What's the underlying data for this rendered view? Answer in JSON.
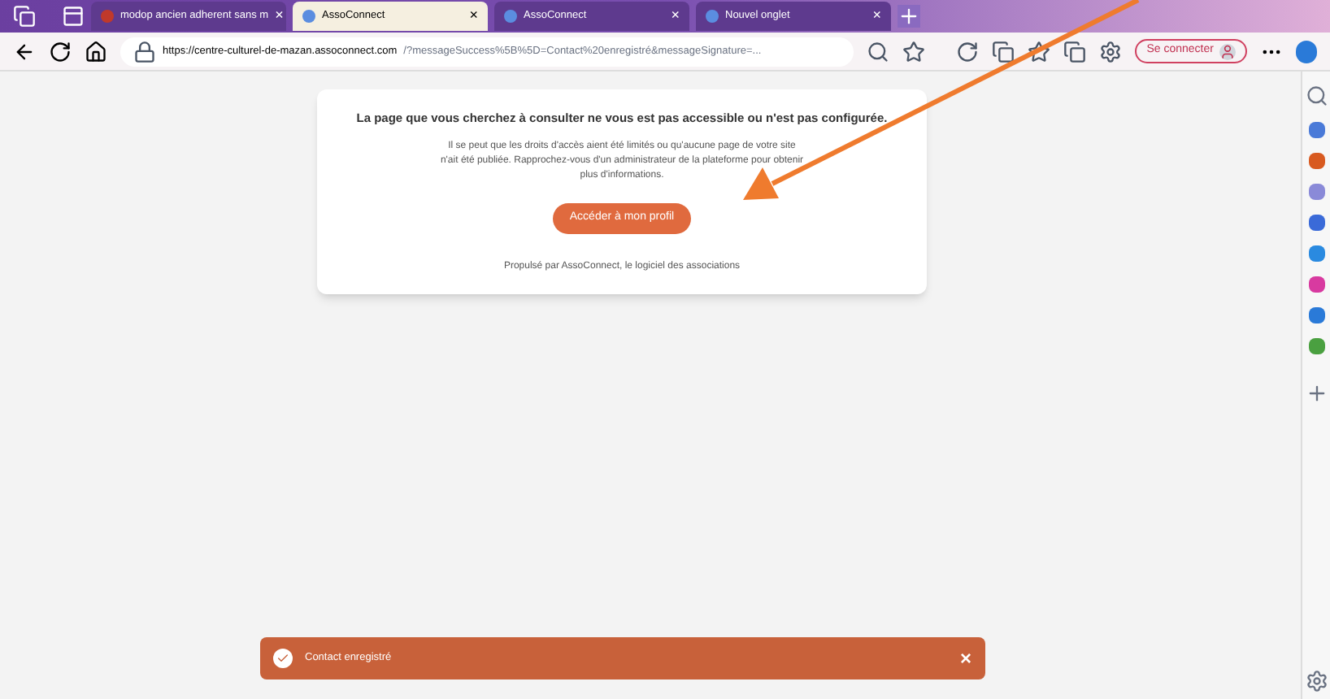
{
  "tabs": [
    {
      "title": "modop ancien adherent sans m",
      "selected": false,
      "close": "×"
    },
    {
      "title": "AssoConnect",
      "selected": true,
      "close": "×"
    },
    {
      "title": "AssoConnect",
      "selected": false,
      "close": "×"
    },
    {
      "title": "Nouvel onglet",
      "selected": false,
      "close": "×"
    }
  ],
  "address_bar": {
    "url_host": "https://centre-culturel-de-mazan.assoconnect.com",
    "url_rest": "/?messageSuccess%5B%5D=Contact%20enregistré&messageSignature=..."
  },
  "sign_in": "Se connecter",
  "card": {
    "heading": "La page que vous cherchez à consulter ne vous est pas accessible ou n'est pas configurée.",
    "body": "Il se peut que les droits d'accès aient été limités ou qu'aucune page de votre site n'ait été publiée. Rapprochez-vous d'un administrateur de la plateforme pour obtenir plus d'informations.",
    "button": "Accéder à mon profil",
    "footer": "Propulsé par AssoConnect, le logiciel des associations"
  },
  "toast": {
    "message": "Contact enregistré",
    "close": "×"
  }
}
